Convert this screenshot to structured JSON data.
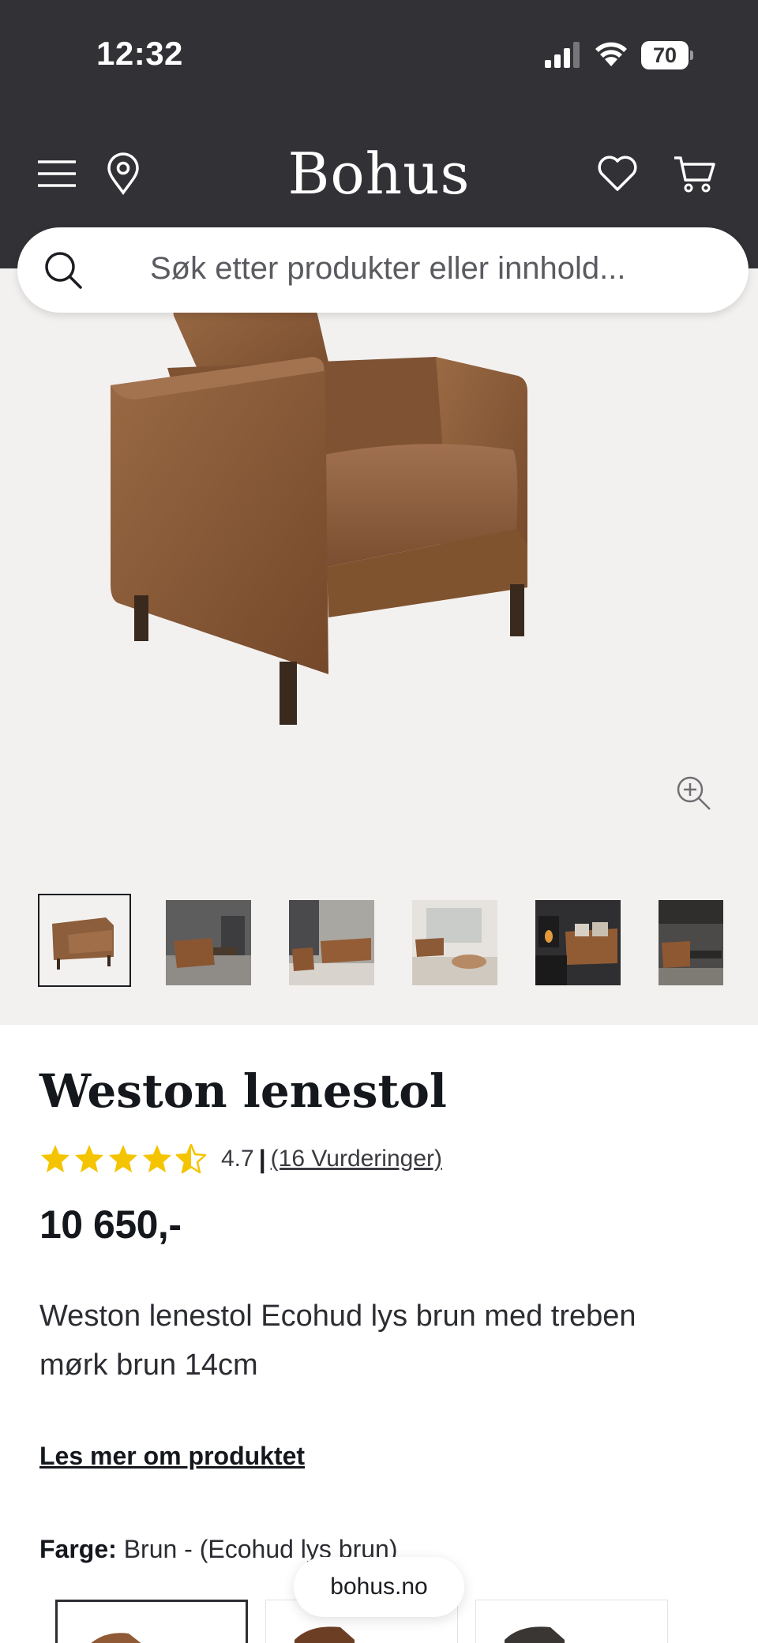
{
  "status_bar": {
    "time": "12:32",
    "battery": "70"
  },
  "header": {
    "logo": "Bohus"
  },
  "search": {
    "placeholder": "Søk etter produkter eller innhold..."
  },
  "product": {
    "title": "Weston lenestol",
    "rating_value": "4.7",
    "rating_separator": "|",
    "reviews_label": "(16 Vurderinger)",
    "stars_filled": 4.5,
    "price": "10 650,-",
    "description": "Weston lenestol Ecohud lys brun med treben mørk brun 14cm",
    "read_more": "Les mer om produktet",
    "color_label": "Farge:",
    "color_value": "Brun - (Ecohud lys brun)"
  },
  "footer_pill": {
    "url": "bohus.no"
  },
  "icons": {
    "menu": "menu-icon",
    "location": "location-pin-icon",
    "wishlist": "heart-icon",
    "cart": "cart-icon",
    "search": "search-icon",
    "zoom": "zoom-in-icon"
  },
  "colors": {
    "header_bg": "#323236",
    "gallery_bg": "#f3f1f0",
    "star": "#f5c400",
    "leather": "#8a5a36"
  }
}
